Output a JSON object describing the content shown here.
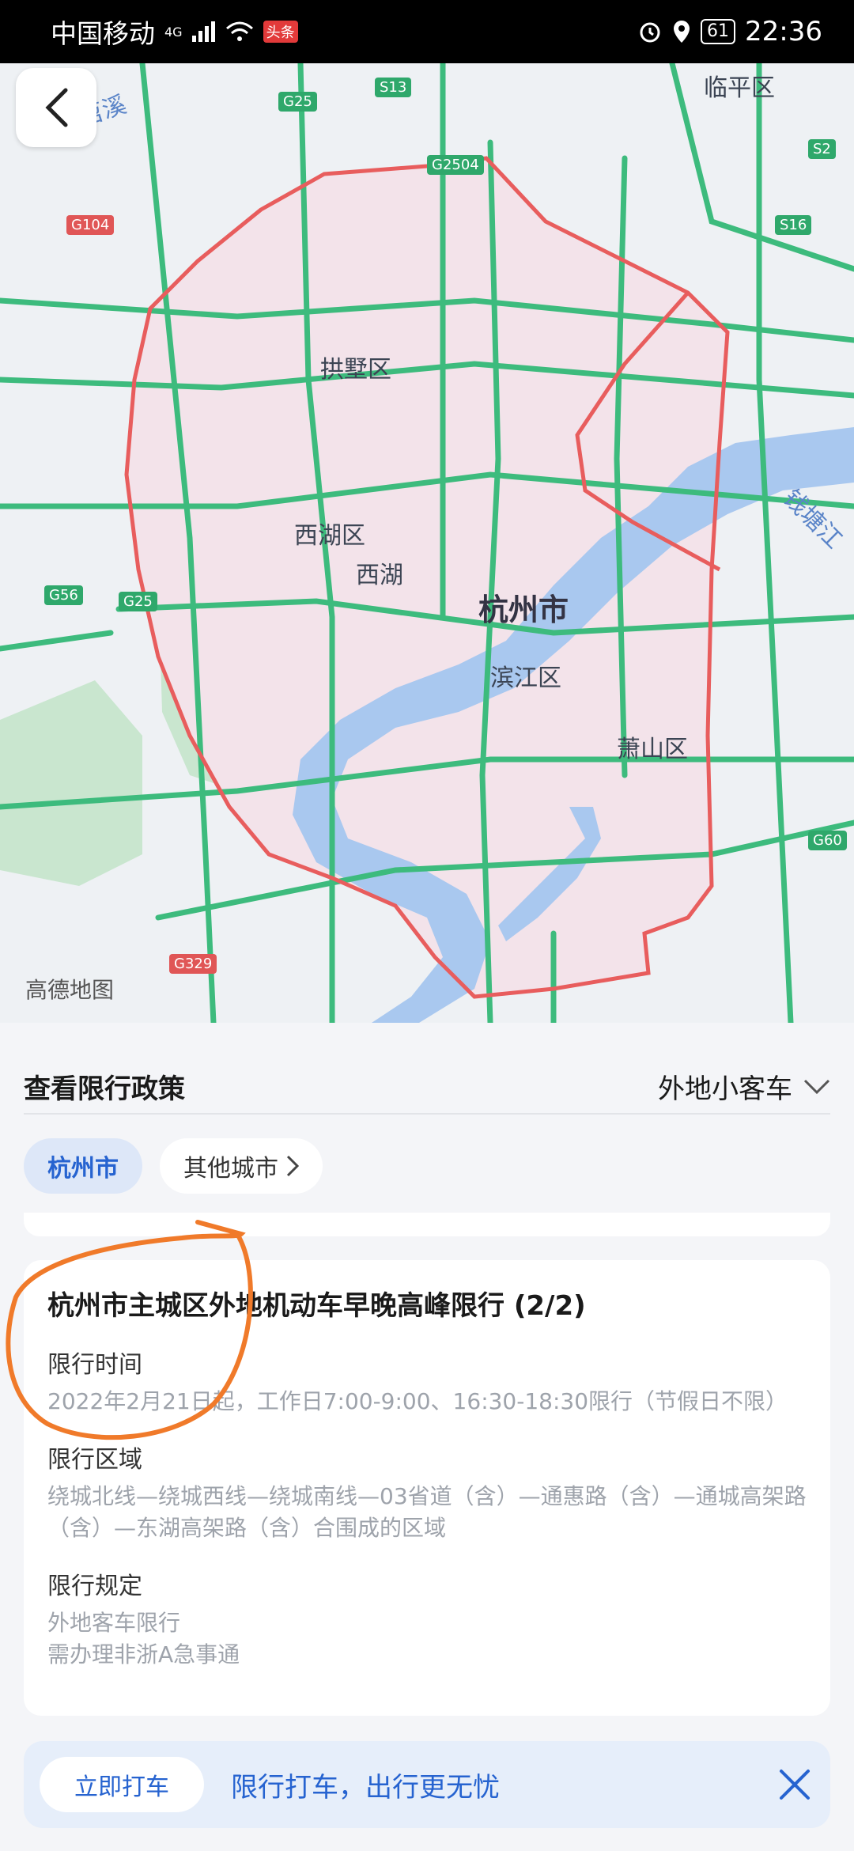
{
  "status_bar": {
    "carrier": "中国移动",
    "network": "4G",
    "news_badge": "头条",
    "battery": "61",
    "time": "22:36"
  },
  "map": {
    "watermark": "高德地图",
    "labels": {
      "linping": "临平区",
      "gongshu": "拱墅区",
      "xihu_district": "西湖区",
      "xihu_lake": "西湖",
      "city": "杭州市",
      "binjiang": "滨江区",
      "xiaoshan": "萧山区",
      "qiantang": "钱塘江",
      "top_left": "东苕溪"
    },
    "shields": {
      "g25_top": "G25",
      "s13": "S13",
      "g2504": "G2504",
      "s2": "S2",
      "s16": "S16",
      "g104": "G104",
      "g56": "G56",
      "g25_left": "G25",
      "g60": "G60",
      "g329": "G329"
    },
    "colors": {
      "zone_fill": "#f3e3ea",
      "boundary": "#e85d5d",
      "road": "#3dbb7d",
      "water": "#a9c8ef",
      "park": "#c9e6cf"
    }
  },
  "sheet": {
    "title": "查看限行政策",
    "vehicle_type": "外地小客车",
    "chips": {
      "active": "杭州市",
      "other": "其他城市"
    }
  },
  "card": {
    "title": "杭州市主城区外地机动车早晚高峰限行 (2/2)",
    "time_label": "限行时间",
    "time_value": "2022年2月21日起，工作日7:00-9:00、16:30-18:30限行（节假日不限）",
    "area_label": "限行区域",
    "area_value": "绕城北线—绕城西线—绕城南线—03省道（含）—通惠路（含）—通城高架路（含）—东湖高架路（含）合围成的区域",
    "rule_label": "限行规定",
    "rule_line1": "外地客车限行",
    "rule_line2": "需办理非浙A急事通"
  },
  "promo": {
    "button": "立即打车",
    "text": "限行打车，出行更无忧"
  },
  "annotation_color": "#f07a2a"
}
